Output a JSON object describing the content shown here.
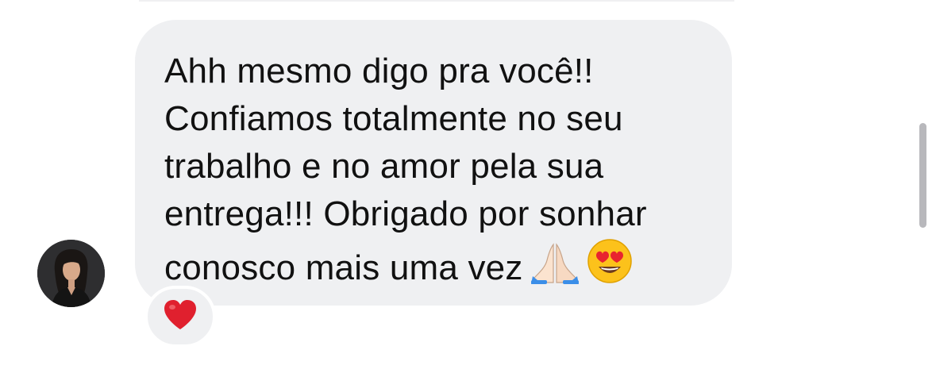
{
  "message": {
    "text_lines": [
      "Ahh mesmo digo pra você!!",
      "Confiamos totalmente no seu",
      "trabalho e no amor pela sua",
      "entrega!!! Obrigado por sonhar",
      "conosco mais uma vez"
    ],
    "trailing_emojis": [
      "praying-hands-icon",
      "smiling-face-with-heart-eyes-icon"
    ]
  },
  "reaction": {
    "emoji": "red-heart-icon"
  },
  "sender": {
    "avatar": "avatar-photo"
  },
  "colors": {
    "bubble_background": "#eff0f2",
    "text": "#111111",
    "heart": "#e0202e",
    "scrollbar": "#b8b8bc"
  }
}
